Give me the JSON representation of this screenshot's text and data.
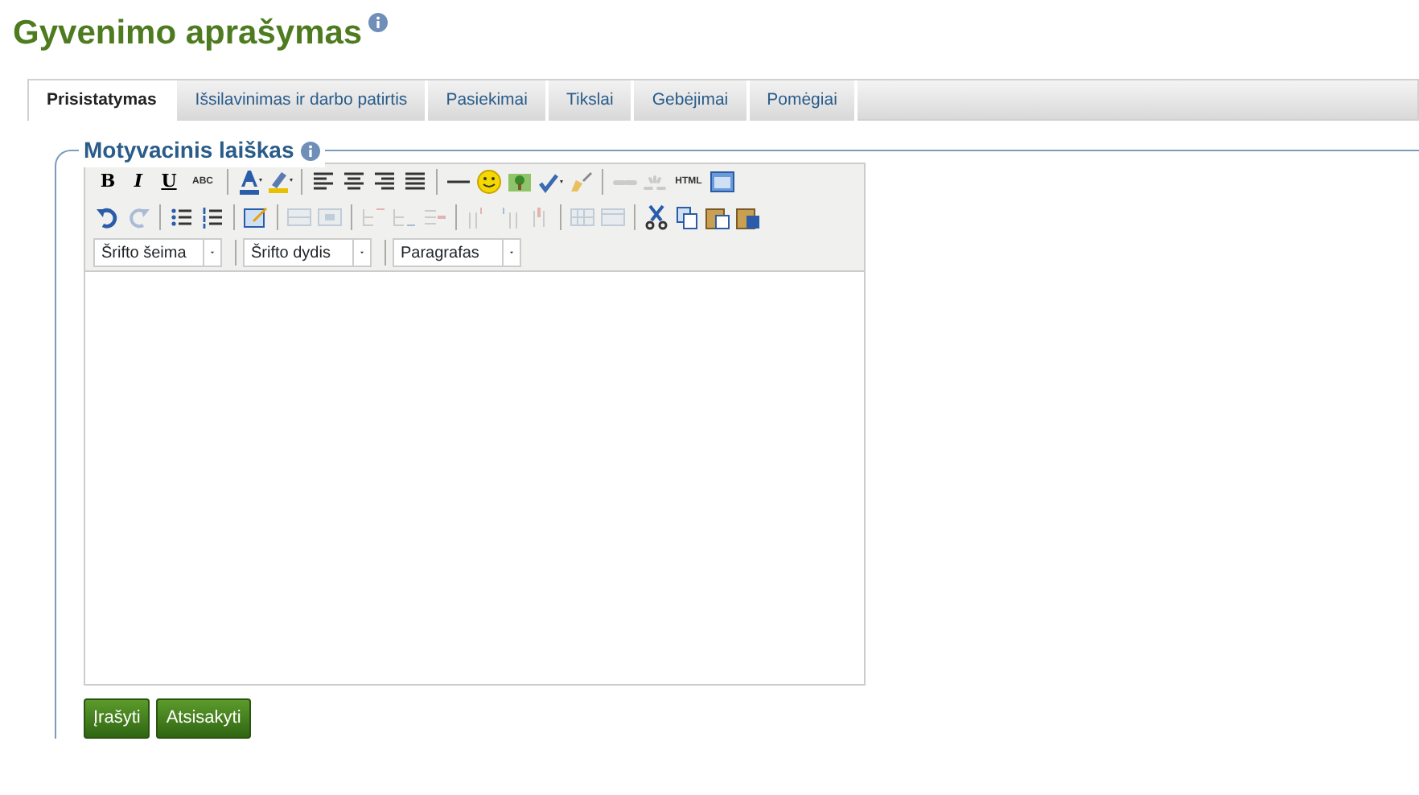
{
  "page_title": "Gyvenimo aprašymas",
  "tabs": [
    {
      "label": "Prisistatymas",
      "selected": true
    },
    {
      "label": "Išsilavinimas ir darbo patirtis",
      "selected": false
    },
    {
      "label": "Pasiekimai",
      "selected": false
    },
    {
      "label": "Tikslai",
      "selected": false
    },
    {
      "label": "Gebėjimai",
      "selected": false
    },
    {
      "label": "Pomėgiai",
      "selected": false
    }
  ],
  "section": {
    "legend": "Motyvacinis laiškas"
  },
  "toolbar_rows": [
    [
      {
        "kind": "text",
        "text": "B",
        "disabled": false
      },
      {
        "kind": "text",
        "text": "I",
        "disabled": false
      },
      {
        "kind": "text",
        "text": "U",
        "disabled": false
      },
      {
        "kind": "text",
        "text": "ABC",
        "disabled": false
      },
      {
        "kind": "sep"
      },
      {
        "kind": "icon",
        "disabled": false
      },
      {
        "kind": "icon",
        "disabled": false
      },
      {
        "kind": "sep"
      },
      {
        "kind": "icon",
        "disabled": false
      },
      {
        "kind": "icon",
        "disabled": false
      },
      {
        "kind": "icon",
        "disabled": false
      },
      {
        "kind": "icon",
        "disabled": false
      },
      {
        "kind": "sep"
      },
      {
        "kind": "icon",
        "disabled": false
      },
      {
        "kind": "icon",
        "disabled": false
      },
      {
        "kind": "icon",
        "disabled": false
      },
      {
        "kind": "icon",
        "disabled": false
      },
      {
        "kind": "icon",
        "disabled": false
      },
      {
        "kind": "sep"
      },
      {
        "kind": "icon",
        "disabled": true
      },
      {
        "kind": "icon",
        "disabled": true
      },
      {
        "kind": "text",
        "text": "HTML",
        "disabled": false
      },
      {
        "kind": "icon",
        "disabled": false
      }
    ],
    [
      {
        "kind": "icon",
        "disabled": false
      },
      {
        "kind": "icon",
        "disabled": true
      },
      {
        "kind": "sep"
      },
      {
        "kind": "icon",
        "disabled": false
      },
      {
        "kind": "icon",
        "disabled": false
      },
      {
        "kind": "sep"
      },
      {
        "kind": "icon",
        "disabled": false
      },
      {
        "kind": "sep"
      },
      {
        "kind": "icon",
        "disabled": true
      },
      {
        "kind": "icon",
        "disabled": true
      },
      {
        "kind": "sep"
      },
      {
        "kind": "icon",
        "disabled": true
      },
      {
        "kind": "icon",
        "disabled": true
      },
      {
        "kind": "icon",
        "disabled": true
      },
      {
        "kind": "sep"
      },
      {
        "kind": "icon",
        "disabled": true
      },
      {
        "kind": "icon",
        "disabled": true
      },
      {
        "kind": "icon",
        "disabled": true
      },
      {
        "kind": "sep"
      },
      {
        "kind": "icon",
        "disabled": true
      },
      {
        "kind": "icon",
        "disabled": true
      },
      {
        "kind": "sep"
      },
      {
        "kind": "icon",
        "disabled": false
      },
      {
        "kind": "icon",
        "disabled": false
      },
      {
        "kind": "icon",
        "disabled": false
      },
      {
        "kind": "icon",
        "disabled": false
      }
    ]
  ],
  "selects": [
    {
      "value": "Šrifto šeima"
    },
    {
      "value": "Šrifto dydis"
    },
    {
      "value": "Paragrafas"
    }
  ],
  "buttons": [
    {
      "label": "Įrašyti"
    },
    {
      "label": "Atsisakyti"
    }
  ]
}
